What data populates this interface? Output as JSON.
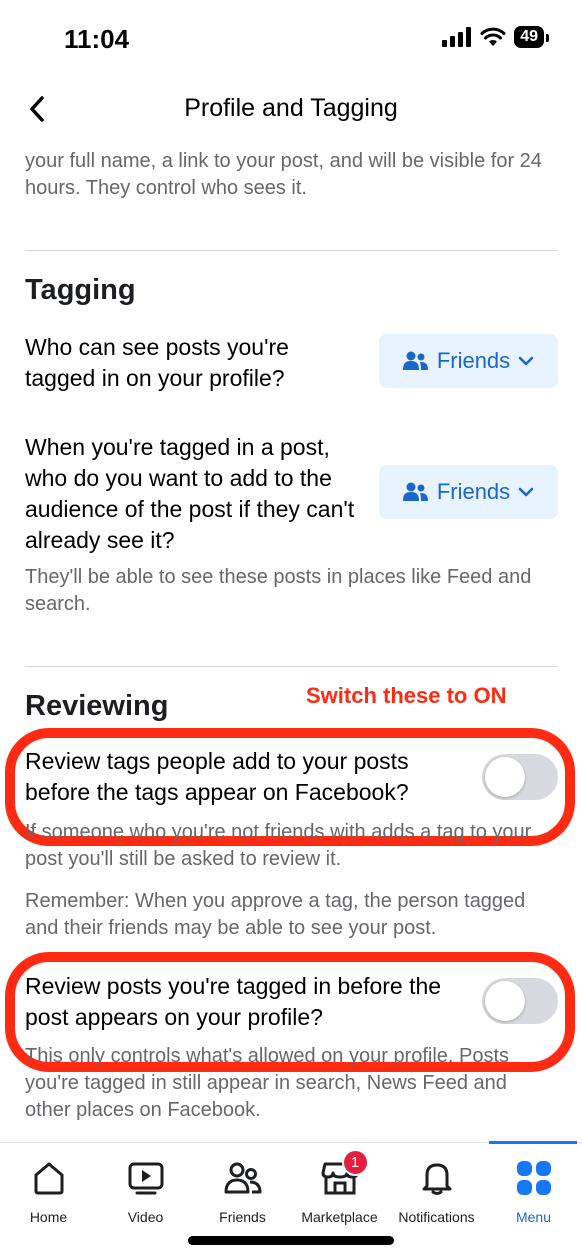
{
  "status_bar": {
    "time": "11:04",
    "battery": "49"
  },
  "header": {
    "title": "Profile and Tagging"
  },
  "intro": {
    "text": "your full name, a link to your post, and will be visible for 24 hours. They control who sees it."
  },
  "tagging": {
    "title": "Tagging",
    "q1": {
      "text": "Who can see posts you're tagged in on your profile?",
      "value": "Friends"
    },
    "q2": {
      "text": "When you're tagged in a post, who do you want to add to the audience of the post if they can't already see it?",
      "value": "Friends"
    },
    "note": "They'll be able to see these posts in places like Feed and search."
  },
  "reviewing": {
    "title": "Reviewing",
    "review_tags": {
      "text": "Review tags people add to your posts before the tags appear on Facebook?",
      "enabled": false
    },
    "review_tags_note": "If someone who you're not friends with adds a tag to your post you'll still be asked to review it.",
    "remember_note": "Remember: When you approve a tag, the person tagged and their friends may be able to see your post.",
    "review_posts": {
      "text": "Review posts you're tagged in before the post appears on your profile?",
      "enabled": false
    },
    "review_posts_note": "This only controls what's allowed on your profile. Posts you're tagged in still appear in search, News Feed and other places on Facebook."
  },
  "annotation": {
    "text": "Switch these to ON",
    "color": "#ff2a12"
  },
  "tabs": [
    {
      "label": "Home",
      "icon": "home-icon"
    },
    {
      "label": "Video",
      "icon": "video-icon"
    },
    {
      "label": "Friends",
      "icon": "friends-icon"
    },
    {
      "label": "Marketplace",
      "icon": "marketplace-icon",
      "badge": "1"
    },
    {
      "label": "Notifications",
      "icon": "bell-icon"
    },
    {
      "label": "Menu",
      "icon": "menu-grid-icon",
      "active": true
    }
  ],
  "colors": {
    "accent": "#1b66c9",
    "badge": "#e41e3f",
    "annotation": "#ff2a12"
  }
}
